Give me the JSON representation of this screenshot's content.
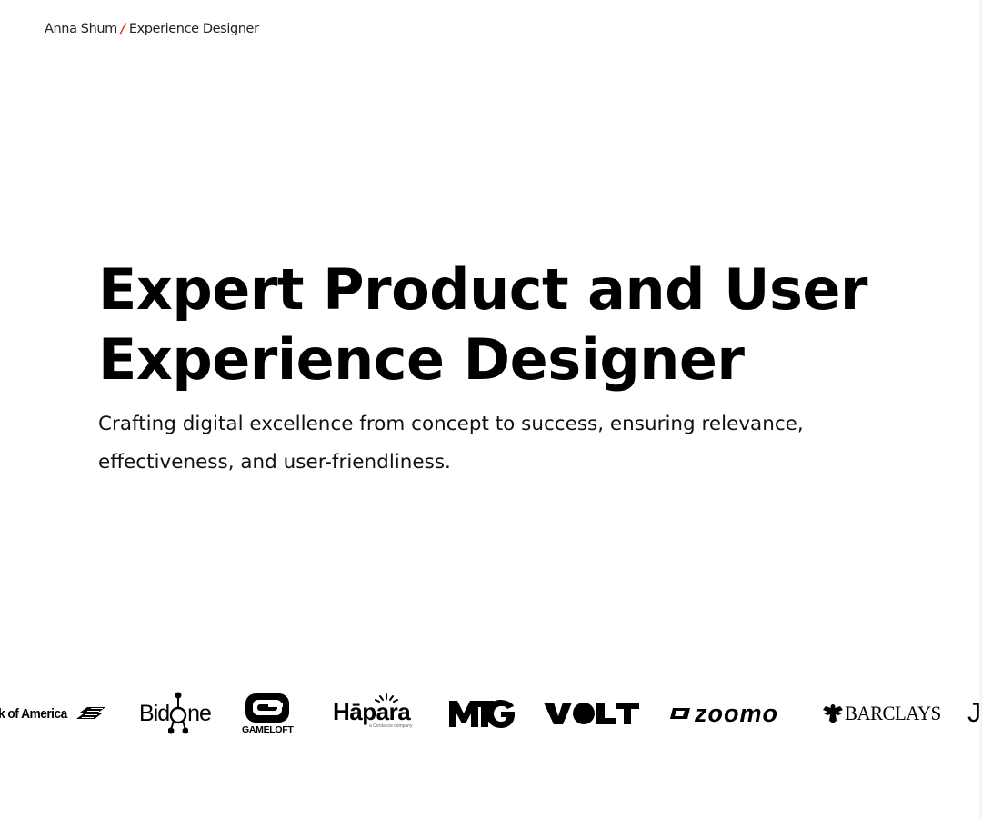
{
  "header": {
    "name": "Anna Shum",
    "separator": "/",
    "role": "Experience Designer"
  },
  "hero": {
    "title_line1": "Expert Product and User",
    "title_line2": "Experience Designer",
    "subtitle": "Crafting digital excellence from concept to success, ensuring relevance, effectiveness, and user-friendliness."
  },
  "logos": {
    "items": [
      {
        "name": "Bank of America",
        "visible_text": "k of America",
        "icon": "bank-of-america-flag-icon"
      },
      {
        "name": "BidOne",
        "visible_text": "BidOne",
        "icon": "bidone-molecule-icon"
      },
      {
        "name": "Gameloft",
        "visible_text": "GAMELOFT",
        "icon": "gameloft-g-icon"
      },
      {
        "name": "Hāpara",
        "visible_text": "Hāpara",
        "icon": "hapara-sun-icon"
      },
      {
        "name": "MTG",
        "visible_text": "MTG",
        "icon": "mtg-logo-icon"
      },
      {
        "name": "VOLT",
        "visible_text": "VOLT",
        "icon": "volt-logo-icon"
      },
      {
        "name": "Zoomo",
        "visible_text": "zoomo",
        "icon": "zoomo-z-icon"
      },
      {
        "name": "Barclays",
        "visible_text": "BARCLAYS",
        "icon": "barclays-eagle-icon"
      },
      {
        "name": "J",
        "visible_text": "J",
        "icon": ""
      }
    ]
  },
  "colors": {
    "accent": "#e8332a",
    "text": "#000000",
    "background": "#ffffff"
  }
}
